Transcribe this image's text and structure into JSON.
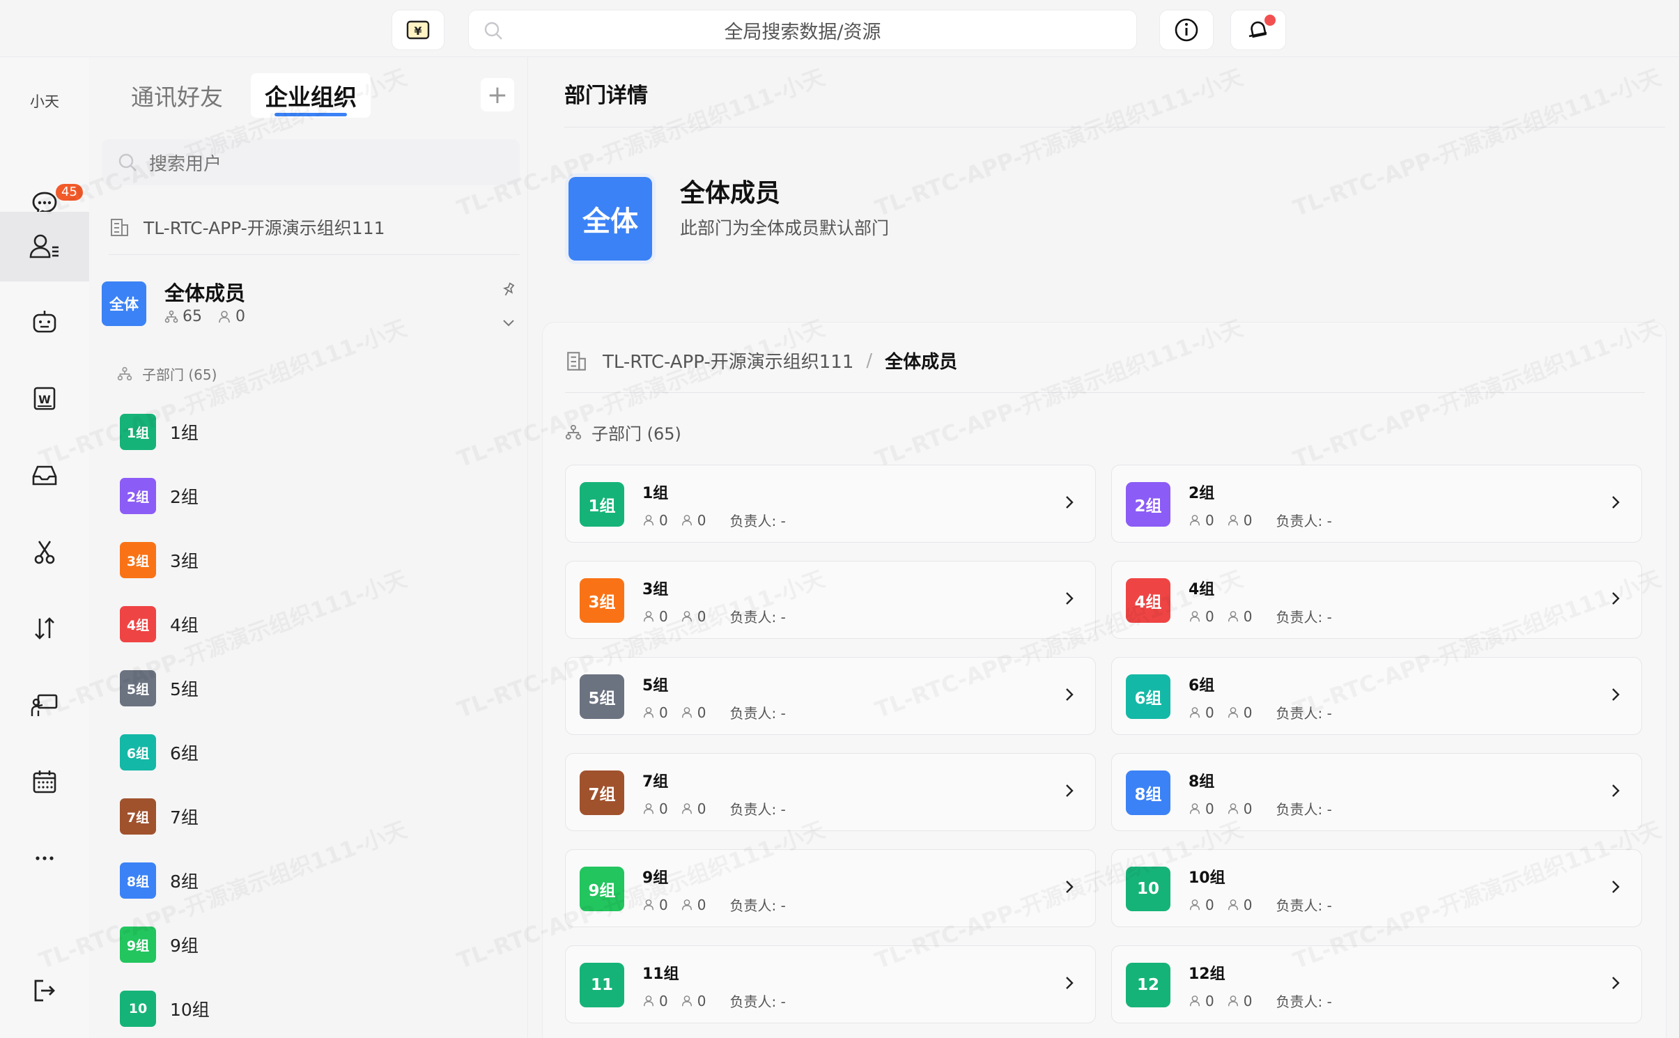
{
  "topbar": {
    "search_placeholder": "全局搜索数据/资源"
  },
  "rail": {
    "user_name": "小天",
    "message_badge": "45",
    "items": [
      "chat-icon",
      "contacts-icon",
      "robot-icon",
      "word-icon",
      "inbox-icon",
      "scissors-icon",
      "sort-icon",
      "presentation-icon",
      "calendar-icon",
      "more-icon",
      "logout-icon"
    ]
  },
  "left": {
    "tab_contacts": "通讯好友",
    "tab_org": "企业组织",
    "add_label": "+",
    "search_placeholder": "搜索用户",
    "org_name": "TL-RTC-APP-开源演示组织111",
    "all": {
      "avatar_text": "全体",
      "title": "全体成员",
      "dept_count": "65",
      "member_count": "0"
    },
    "sub_head": "子部门 (65)",
    "tree": [
      {
        "avatar": "1组",
        "name": "1组",
        "color": "#16b378"
      },
      {
        "avatar": "2组",
        "name": "2组",
        "color": "#8b5cf6"
      },
      {
        "avatar": "3组",
        "name": "3组",
        "color": "#f97316"
      },
      {
        "avatar": "4组",
        "name": "4组",
        "color": "#ef4444"
      },
      {
        "avatar": "5组",
        "name": "5组",
        "color": "#6b7280"
      },
      {
        "avatar": "6组",
        "name": "6组",
        "color": "#14b8a6"
      },
      {
        "avatar": "7组",
        "name": "7组",
        "color": "#a0522d"
      },
      {
        "avatar": "8组",
        "name": "8组",
        "color": "#3b82f6"
      },
      {
        "avatar": "9组",
        "name": "9组",
        "color": "#22c55e"
      },
      {
        "avatar": "10",
        "name": "10组",
        "color": "#16b378"
      }
    ]
  },
  "main": {
    "title": "部门详情",
    "big_avatar": "全体",
    "dept_name": "全体成员",
    "dept_desc": "此部门为全体成员默认部门",
    "crumb_org": "TL-RTC-APP-开源演示组织111",
    "crumb_sep": "/",
    "crumb_current": "全体成员",
    "sub_head": "子部门 (65)",
    "cards": [
      {
        "avatar": "1组",
        "name": "1组",
        "a": "0",
        "b": "0",
        "lead": "负责人: -",
        "color": "#16b378"
      },
      {
        "avatar": "2组",
        "name": "2组",
        "a": "0",
        "b": "0",
        "lead": "负责人: -",
        "color": "#8b5cf6"
      },
      {
        "avatar": "3组",
        "name": "3组",
        "a": "0",
        "b": "0",
        "lead": "负责人: -",
        "color": "#f97316"
      },
      {
        "avatar": "4组",
        "name": "4组",
        "a": "0",
        "b": "0",
        "lead": "负责人: -",
        "color": "#ef4444"
      },
      {
        "avatar": "5组",
        "name": "5组",
        "a": "0",
        "b": "0",
        "lead": "负责人: -",
        "color": "#6b7280"
      },
      {
        "avatar": "6组",
        "name": "6组",
        "a": "0",
        "b": "0",
        "lead": "负责人: -",
        "color": "#14b8a6"
      },
      {
        "avatar": "7组",
        "name": "7组",
        "a": "0",
        "b": "0",
        "lead": "负责人: -",
        "color": "#a0522d"
      },
      {
        "avatar": "8组",
        "name": "8组",
        "a": "0",
        "b": "0",
        "lead": "负责人: -",
        "color": "#3b82f6"
      },
      {
        "avatar": "9组",
        "name": "9组",
        "a": "0",
        "b": "0",
        "lead": "负责人: -",
        "color": "#22c55e"
      },
      {
        "avatar": "10",
        "name": "10组",
        "a": "0",
        "b": "0",
        "lead": "负责人: -",
        "color": "#16b378"
      },
      {
        "avatar": "11",
        "name": "11组",
        "a": "0",
        "b": "0",
        "lead": "负责人: -",
        "color": "#16b378"
      },
      {
        "avatar": "12",
        "name": "12组",
        "a": "0",
        "b": "0",
        "lead": "负责人: -",
        "color": "#16b378"
      }
    ]
  },
  "watermark": "TL-RTC-APP-开源演示组织111-小天"
}
